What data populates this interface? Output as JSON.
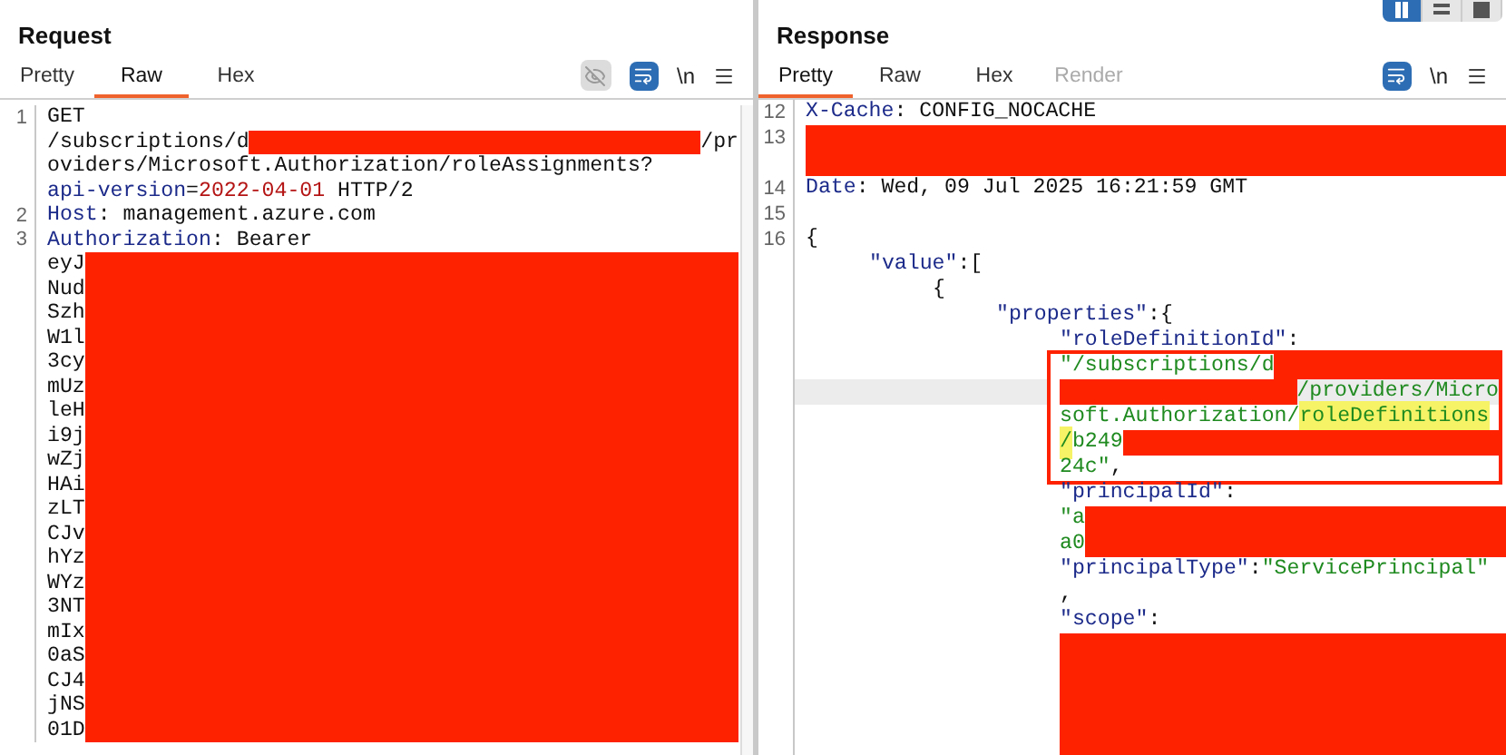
{
  "layout_buttons": [
    {
      "kind": "columns",
      "selected": true
    },
    {
      "kind": "rows",
      "selected": false
    },
    {
      "kind": "single",
      "selected": false
    }
  ],
  "request": {
    "title": "Request",
    "tabs": [
      {
        "label": "Pretty",
        "selected": false,
        "disabled": false
      },
      {
        "label": "Raw",
        "selected": true,
        "disabled": false
      },
      {
        "label": "Hex",
        "selected": false,
        "disabled": false
      }
    ],
    "tools": [
      {
        "kind": "hide"
      },
      {
        "kind": "wrap"
      },
      {
        "kind": "newline",
        "text": "\\n"
      },
      {
        "kind": "menu"
      }
    ],
    "rows": [
      {
        "number": "1",
        "segments": [
          {
            "kind": "plain",
            "text": "GET"
          }
        ]
      },
      {
        "segments": [
          {
            "kind": "plain",
            "text": "/subscriptions/d"
          },
          {
            "kind": "redacted"
          },
          {
            "kind": "plain",
            "text": "/pr"
          }
        ]
      },
      {
        "segments": [
          {
            "kind": "plain",
            "text": "oviders/Microsoft.Authorization/roleAssignments?"
          }
        ]
      },
      {
        "segments": [
          {
            "kind": "key",
            "text": "api-version"
          },
          {
            "kind": "plain",
            "text": "="
          },
          {
            "kind": "param",
            "text": "2022-04-01"
          },
          {
            "kind": "plain",
            "text": " HTTP/2"
          }
        ]
      },
      {
        "number": "2",
        "segments": [
          {
            "kind": "key",
            "text": "Host"
          },
          {
            "kind": "plain",
            "text": ": management.azure.com"
          }
        ]
      },
      {
        "number": "3",
        "segments": [
          {
            "kind": "key",
            "text": "Authorization"
          },
          {
            "kind": "plain",
            "text": ": Bearer"
          }
        ]
      },
      {
        "segments": [
          {
            "kind": "plain",
            "text": "eyJ"
          },
          {
            "kind": "redacted"
          }
        ]
      },
      {
        "segments": [
          {
            "kind": "plain",
            "text": "Nud"
          },
          {
            "kind": "redacted"
          }
        ]
      },
      {
        "segments": [
          {
            "kind": "plain",
            "text": "Szh"
          },
          {
            "kind": "redacted"
          }
        ]
      },
      {
        "segments": [
          {
            "kind": "plain",
            "text": "W1l"
          },
          {
            "kind": "redacted"
          }
        ]
      },
      {
        "segments": [
          {
            "kind": "plain",
            "text": "3cy"
          },
          {
            "kind": "redacted"
          }
        ]
      },
      {
        "segments": [
          {
            "kind": "plain",
            "text": "mUz"
          },
          {
            "kind": "redacted"
          }
        ]
      },
      {
        "segments": [
          {
            "kind": "plain",
            "text": "leH"
          },
          {
            "kind": "redacted"
          }
        ]
      },
      {
        "segments": [
          {
            "kind": "plain",
            "text": "i9j"
          },
          {
            "kind": "redacted"
          }
        ]
      },
      {
        "segments": [
          {
            "kind": "plain",
            "text": "wZj"
          },
          {
            "kind": "redacted"
          }
        ]
      },
      {
        "segments": [
          {
            "kind": "plain",
            "text": "HAi"
          },
          {
            "kind": "redacted"
          }
        ]
      },
      {
        "segments": [
          {
            "kind": "plain",
            "text": "zLT"
          },
          {
            "kind": "redacted"
          }
        ]
      },
      {
        "segments": [
          {
            "kind": "plain",
            "text": "CJv"
          },
          {
            "kind": "redacted"
          }
        ]
      },
      {
        "segments": [
          {
            "kind": "plain",
            "text": "hYz"
          },
          {
            "kind": "redacted"
          }
        ]
      },
      {
        "segments": [
          {
            "kind": "plain",
            "text": "WYz"
          },
          {
            "kind": "redacted"
          }
        ]
      },
      {
        "segments": [
          {
            "kind": "plain",
            "text": "3NT"
          },
          {
            "kind": "redacted"
          }
        ]
      },
      {
        "segments": [
          {
            "kind": "plain",
            "text": "mIx"
          },
          {
            "kind": "redacted"
          }
        ]
      },
      {
        "segments": [
          {
            "kind": "plain",
            "text": "0aS"
          },
          {
            "kind": "redacted"
          }
        ]
      },
      {
        "segments": [
          {
            "kind": "plain",
            "text": "CJ4"
          },
          {
            "kind": "redacted"
          }
        ]
      },
      {
        "segments": [
          {
            "kind": "plain",
            "text": "jNS"
          },
          {
            "kind": "redacted"
          }
        ]
      },
      {
        "segments": [
          {
            "kind": "plain",
            "text": "01D"
          },
          {
            "kind": "redacted"
          }
        ]
      }
    ]
  },
  "response": {
    "title": "Response",
    "tabs": [
      {
        "label": "Pretty",
        "selected": true,
        "disabled": false
      },
      {
        "label": "Raw",
        "selected": false,
        "disabled": false
      },
      {
        "label": "Hex",
        "selected": false,
        "disabled": false
      },
      {
        "label": "Render",
        "selected": false,
        "disabled": true
      }
    ],
    "tools": [
      {
        "kind": "wrap"
      },
      {
        "kind": "newline",
        "text": "\\n"
      },
      {
        "kind": "menu"
      }
    ],
    "rows": [
      {
        "kind": "line",
        "number": "12",
        "current": false,
        "segments": [
          {
            "kind": "key",
            "text": "X-Cache"
          },
          {
            "kind": "plain",
            "text": ": CONFIG_NOCACHE"
          }
        ]
      },
      {
        "kind": "line",
        "number": "13",
        "current": false,
        "segments": [
          {
            "kind": "redacted"
          }
        ]
      },
      {
        "kind": "line",
        "current": false,
        "segments": [
          {
            "kind": "redacted"
          }
        ]
      },
      {
        "kind": "line",
        "number": "14",
        "current": false,
        "segments": [
          {
            "kind": "key",
            "text": "Date"
          },
          {
            "kind": "plain",
            "text": ": Wed, 09 Jul 2025 16:21:59 GMT"
          }
        ]
      },
      {
        "kind": "line",
        "number": "15",
        "current": false
      },
      {
        "kind": "line",
        "number": "16",
        "current": false,
        "segments": [
          {
            "kind": "plain",
            "text": "{"
          }
        ],
        "children": [
          {
            "kind": "line",
            "current": false,
            "segments": [
              {
                "kind": "key",
                "text": "\"value\""
              },
              {
                "kind": "plain",
                "text": ":["
              }
            ],
            "children": [
              {
                "kind": "line",
                "current": false,
                "segments": [
                  {
                    "kind": "plain",
                    "text": "{"
                  }
                ],
                "children": [
                  {
                    "kind": "line",
                    "current": false,
                    "segments": [
                      {
                        "kind": "key",
                        "text": "\"properties\""
                      },
                      {
                        "kind": "plain",
                        "text": ":{"
                      }
                    ],
                    "children": [
                      {
                        "kind": "line",
                        "current": false,
                        "segments": [
                          {
                            "kind": "key",
                            "text": "\"roleDefinitionId\""
                          },
                          {
                            "kind": "plain",
                            "text": ":"
                          }
                        ]
                      },
                      {
                        "kind": "boxed",
                        "rows": [
                          {
                            "current": false,
                            "segments": [
                              {
                                "kind": "string",
                                "text": "\"/subscriptions/d"
                              },
                              {
                                "kind": "redacted"
                              }
                            ]
                          },
                          {
                            "current": true,
                            "segments": [
                              {
                                "kind": "redacted"
                              },
                              {
                                "kind": "string",
                                "text": "/providers/Micro"
                              }
                            ]
                          },
                          {
                            "current": false,
                            "segments": [
                              {
                                "kind": "string",
                                "text": "soft.Authorization/"
                              },
                              {
                                "kind": "highlight",
                                "text": "roleDefinitions"
                              }
                            ]
                          },
                          {
                            "current": false,
                            "segments": [
                              {
                                "kind": "highlight",
                                "text": "/"
                              },
                              {
                                "kind": "string",
                                "text": "b249"
                              },
                              {
                                "kind": "redacted"
                              }
                            ]
                          },
                          {
                            "current": false,
                            "segments": [
                              {
                                "kind": "string",
                                "text": "24c\""
                              },
                              {
                                "kind": "plain",
                                "text": ","
                              }
                            ]
                          }
                        ]
                      },
                      {
                        "kind": "line",
                        "current": false,
                        "segments": [
                          {
                            "kind": "key",
                            "text": "\"principalId\""
                          },
                          {
                            "kind": "plain",
                            "text": ":"
                          }
                        ]
                      },
                      {
                        "kind": "line",
                        "current": false,
                        "segments": [
                          {
                            "kind": "string",
                            "text": "\"a"
                          },
                          {
                            "kind": "redacted"
                          }
                        ]
                      },
                      {
                        "kind": "line",
                        "current": false,
                        "segments": [
                          {
                            "kind": "string",
                            "text": "a0"
                          },
                          {
                            "kind": "redacted"
                          }
                        ]
                      },
                      {
                        "kind": "line",
                        "current": false,
                        "segments": [
                          {
                            "kind": "key",
                            "text": "\"principalType\""
                          },
                          {
                            "kind": "plain",
                            "text": ":"
                          },
                          {
                            "kind": "string",
                            "text": "\"ServicePrincipal\""
                          }
                        ]
                      },
                      {
                        "kind": "line",
                        "current": false,
                        "segments": [
                          {
                            "kind": "plain",
                            "text": ","
                          }
                        ]
                      },
                      {
                        "kind": "line",
                        "current": false,
                        "segments": [
                          {
                            "kind": "key",
                            "text": "\"scope\""
                          },
                          {
                            "kind": "plain",
                            "text": ":"
                          }
                        ]
                      },
                      {
                        "kind": "line",
                        "current": false,
                        "segments": [
                          {
                            "kind": "redacted"
                          }
                        ]
                      },
                      {
                        "kind": "line",
                        "current": false,
                        "segments": [
                          {
                            "kind": "redacted"
                          }
                        ]
                      },
                      {
                        "kind": "line",
                        "current": false,
                        "segments": [
                          {
                            "kind": "redacted"
                          }
                        ]
                      },
                      {
                        "kind": "line",
                        "current": false,
                        "segments": [
                          {
                            "kind": "redacted"
                          }
                        ]
                      },
                      {
                        "kind": "line",
                        "current": false,
                        "segments": [
                          {
                            "kind": "redacted"
                          }
                        ]
                      }
                    ]
                  }
                ]
              }
            ]
          }
        ]
      }
    ]
  }
}
